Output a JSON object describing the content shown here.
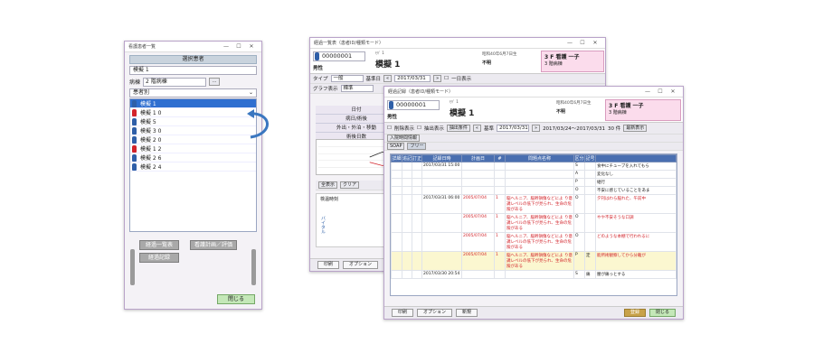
{
  "w1": {
    "title": "看護患者一覧",
    "header": "選択患者",
    "selected_patient": "模擬 1",
    "ward_label": "病棟",
    "ward_value": "2 階病棟",
    "ward_btn": "...",
    "sort_label": "患者別",
    "patients": [
      {
        "name": "模擬 1",
        "sex": "m",
        "selected": true
      },
      {
        "name": "模擬 1 0",
        "sex": "f",
        "selected": false
      },
      {
        "name": "模擬 5",
        "sex": "m",
        "selected": false
      },
      {
        "name": "模擬 3 0",
        "sex": "m",
        "selected": false
      },
      {
        "name": "模擬 2 0",
        "sex": "m",
        "selected": false
      },
      {
        "name": "模擬 1 2",
        "sex": "f",
        "selected": false
      },
      {
        "name": "模擬 2 6",
        "sex": "m",
        "selected": false
      },
      {
        "name": "模擬 2 4",
        "sex": "m",
        "selected": false
      }
    ],
    "btn_list": "経過一覧表",
    "btn_plan": "看護計画／評価",
    "btn_record": "経過記録",
    "btn_close": "閉じる"
  },
  "w2": {
    "title": "経過一覧表（患者ID/種類モード）",
    "patient_id": "00000001",
    "kana": "ﾓｷﾞ 1",
    "name": "模擬 1",
    "sex": "男性",
    "birth": "昭和40年6月7日生",
    "age": "不明",
    "height_label": "身",
    "weight_label": "体",
    "ward_info": "3 F 看護 一子",
    "ward_sub": "3 階病棟",
    "type_label": "タイプ",
    "type_value": "一般",
    "base_label": "基準日",
    "date_value": "2017/03/31",
    "oneday": "一日表示",
    "graph_label": "グラフ表示",
    "graph_value": "標準",
    "rows": [
      "日付",
      "病日/術後",
      "外出・外泊・移動",
      "術後日数"
    ],
    "vitals_label": "バイタル",
    "vitals_time": "検温時刻",
    "btn_all": "全表示",
    "btn_clear": "クリア",
    "bottom_print": "印刷",
    "bottom_option": "オプション"
  },
  "w3": {
    "title": "経過記録（患者ID/種類モード）",
    "patient_id": "00000001",
    "kana": "ﾓｷﾞ 1",
    "name": "模擬 1",
    "sex": "男性",
    "birth": "昭和40年6月7日生",
    "age": "不明",
    "ward_info": "3 F 看護 一子",
    "ward_sub": "3 階病棟",
    "chk_delete": "削除表示",
    "chk_extract": "抽出表示",
    "extract_cond": "抽出条件",
    "base_label": "基準",
    "date_value": "2017/03/31",
    "range": "2017/03/24～2017/03/31",
    "days": "30 件",
    "latest": "最新表示",
    "tab_admission": "入院時間情報",
    "tab_soap": "SOAP",
    "tab_free": "フリー",
    "columns": [
      "詳細",
      "追記",
      "訂正",
      "記録日時",
      "計画日",
      "#",
      "問題点名称",
      "区分",
      "記号",
      ""
    ],
    "rows": [
      {
        "date": "2017/03/31 15:00",
        "plan": "",
        "no": "",
        "problem": "",
        "kubun": "S",
        "mark": "",
        "text": "食中にチューブを入れてもら",
        "red": false,
        "yellow": false
      },
      {
        "date": "",
        "plan": "",
        "no": "",
        "problem": "",
        "kubun": "A",
        "mark": "",
        "text": "変化なし",
        "red": false,
        "yellow": false
      },
      {
        "date": "",
        "plan": "",
        "no": "",
        "problem": "",
        "kubun": "P",
        "mark": "",
        "text": "継行",
        "red": false,
        "yellow": false
      },
      {
        "date": "",
        "plan": "",
        "no": "",
        "problem": "",
        "kubun": "O",
        "mark": "",
        "text": "不安に感じていることをあま",
        "red": false,
        "yellow": false
      },
      {
        "date": "2017/03/31 06:00",
        "plan": "2005/07/04",
        "no": "1",
        "problem": "脳ヘルニア、脳幹損傷などによ り意識レベルの低下が見られ、生命の危険がある",
        "kubun": "O",
        "mark": "",
        "text": "夕刊はわら脳れた、午前中",
        "red": true,
        "yellow": false
      },
      {
        "date": "",
        "plan": "2005/07/04",
        "no": "1",
        "problem": "脳ヘルニア、脳幹損傷などによ り意識レベルの低下が見られ、生命の危険がある",
        "kubun": "O",
        "mark": "",
        "text": "やや不安そうな口調",
        "red": true,
        "yellow": false
      },
      {
        "date": "",
        "plan": "2005/07/04",
        "no": "1",
        "problem": "脳ヘルニア、脳幹損傷などによ り意識レベルの低下が見られ、生命の危険がある",
        "kubun": "O",
        "mark": "",
        "text": "どのような本棚で行われるに",
        "red": true,
        "yellow": false
      },
      {
        "date": "",
        "plan": "2005/07/04",
        "no": "1",
        "problem": "脳ヘルニア、脳幹損傷などによ り意識レベルの低下が見られ、生命の危険がある",
        "kubun": "P",
        "mark": "定",
        "text": "能所術観察してから分離が",
        "red": true,
        "yellow": true
      },
      {
        "date": "2017/03/30 20:54",
        "plan": "",
        "no": "",
        "problem": "",
        "kubun": "S",
        "mark": "痛",
        "text": "腰が痛っとする",
        "red": false,
        "yellow": false
      }
    ],
    "bottom_print": "印刷",
    "bottom_option": "オプション",
    "bottom_new": "新規",
    "btn_ok": "登録",
    "btn_close": "閉じる"
  },
  "colors": {
    "accent": "#2f6fd0",
    "male": "#2f5fa8",
    "female": "#d2232a",
    "pink": "#fbdcec"
  }
}
